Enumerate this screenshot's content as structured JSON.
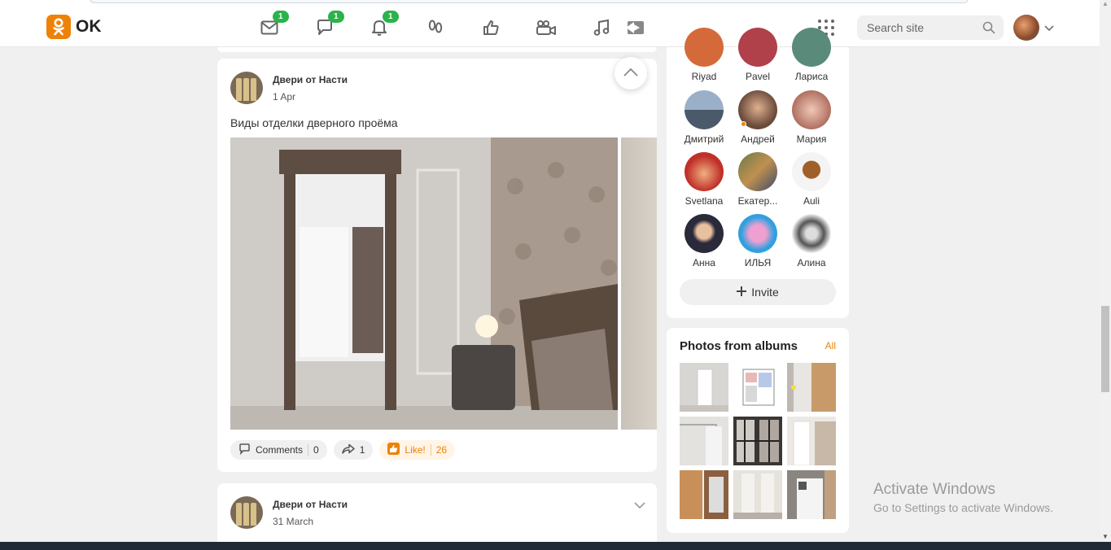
{
  "header": {
    "logo_text": "OK",
    "nav": [
      {
        "name": "messages-icon",
        "badge": "1"
      },
      {
        "name": "discussions-icon",
        "badge": "1"
      },
      {
        "name": "notifications-icon",
        "badge": "1"
      },
      {
        "name": "guests-icon",
        "badge": ""
      },
      {
        "name": "ratings-icon",
        "badge": ""
      },
      {
        "name": "video-icon",
        "badge": ""
      },
      {
        "name": "music-icon",
        "badge": ""
      },
      {
        "name": "play-icon",
        "badge": ""
      }
    ],
    "search_placeholder": "Search site"
  },
  "feed": {
    "post1": {
      "author": "Двери от Насти",
      "date": "1 Apr",
      "text": "Виды отделки дверного проёма",
      "comments_label": "Comments",
      "comments_count": "0",
      "shares_count": "1",
      "like_label": "Like!",
      "likes_count": "26"
    },
    "post2": {
      "author": "Двери от Насти",
      "date": "31 March"
    }
  },
  "friends": {
    "items": [
      {
        "name": "Riyad",
        "color": "#d46a3a"
      },
      {
        "name": "Pavel",
        "color": "#b0404a"
      },
      {
        "name": "Лариса",
        "color": "#5a8a7a"
      },
      {
        "name": "Дмитрий",
        "color": "#5a6a7a"
      },
      {
        "name": "Андрей",
        "color": "#8a6a4a"
      },
      {
        "name": "Мария",
        "color": "#c88a7a"
      },
      {
        "name": "Svetlana",
        "color": "#c0302a"
      },
      {
        "name": "Екатер...",
        "color": "#6a7a4a"
      },
      {
        "name": "Auli",
        "color": "#a0602a"
      },
      {
        "name": "Анна",
        "color": "#2a2a3a"
      },
      {
        "name": "ИЛЬЯ",
        "color": "#e040a0"
      },
      {
        "name": "Алина",
        "color": "#555555"
      }
    ],
    "invite_label": "Invite"
  },
  "albums": {
    "title": "Photos from albums",
    "all_label": "All"
  },
  "windows": {
    "activate_title": "Activate Windows",
    "activate_sub": "Go to Settings to activate Windows."
  },
  "colors": {
    "accent": "#ee8208",
    "badge": "#2bb34a"
  }
}
